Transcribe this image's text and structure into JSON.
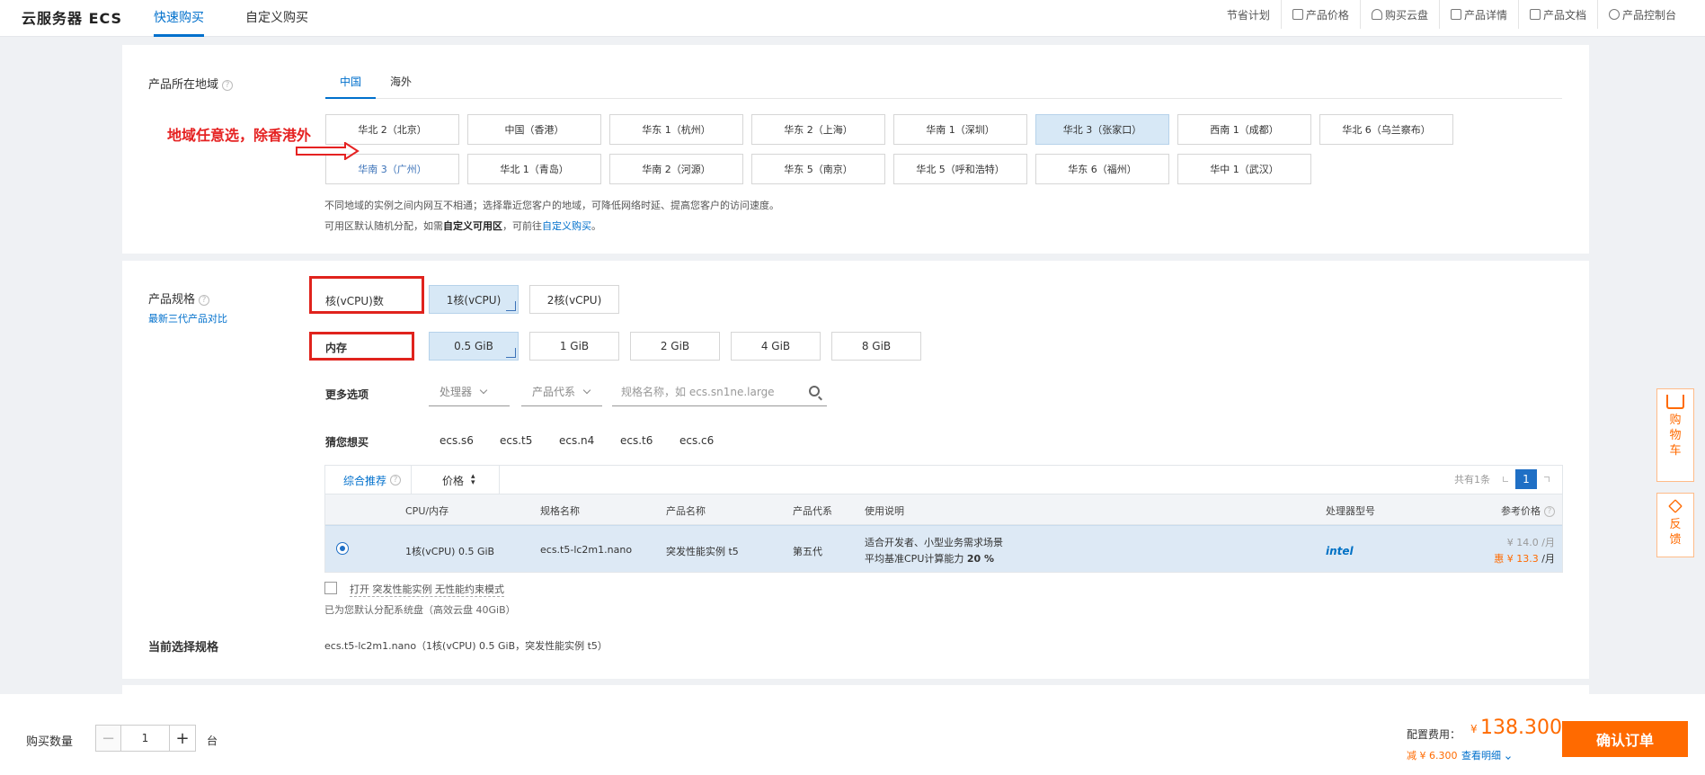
{
  "header": {
    "brand": "云服务器 ECS",
    "tabs": [
      "快速购买",
      "自定义购买"
    ],
    "right_links": [
      "节省计划",
      "产品价格",
      "购买云盘",
      "产品详情",
      "产品文档",
      "产品控制台"
    ]
  },
  "region": {
    "label": "产品所在地域",
    "tabs": [
      "中国",
      "海外"
    ],
    "buttons_row1": [
      "华北 2（北京）",
      "中国（香港）",
      "华东 1（杭州）",
      "华东 2（上海）",
      "华南 1（深圳）",
      "华北 3（张家口）",
      "西南 1（成都）",
      "华北 6（乌兰察布）"
    ],
    "buttons_row2": [
      "华南 3（广州）",
      "华北 1（青岛）",
      "华南 2（河源）",
      "华东 5（南京）",
      "华北 5（呼和浩特）",
      "华东 6（福州）",
      "华中 1（武汉）"
    ],
    "selected": "华北 3（张家口）",
    "note1": "不同地域的实例之间内网互不相通；选择靠近您客户的地域，可降低网络时延、提高您客户的访问速度。",
    "note2_pre": "可用区默认随机分配，如需",
    "note2_bold": "自定义可用区",
    "note2_mid": "，可前往",
    "note2_link": "自定义购买",
    "note2_post": "。"
  },
  "annotation": {
    "text": "地域任意选，除香港外",
    "color": "#e52222"
  },
  "spec": {
    "label": "产品规格",
    "compare_link": "最新三代产品对比",
    "cpu_label": "核(vCPU)数",
    "cpu_options": [
      "1核(vCPU)",
      "2核(vCPU)"
    ],
    "mem_label": "内存",
    "mem_options": [
      "0.5 GiB",
      "1 GiB",
      "2 GiB",
      "4 GiB",
      "8 GiB"
    ],
    "more_label": "更多选项",
    "dropdown_processor": "处理器",
    "dropdown_gen": "产品代系",
    "search_placeholder": "规格名称，如 ecs.sn1ne.large",
    "guess_label": "猜您想买",
    "guess_items": [
      "ecs.s6",
      "ecs.t5",
      "ecs.n4",
      "ecs.t6",
      "ecs.c6"
    ]
  },
  "table": {
    "tab_recommend": "综合推荐",
    "tab_price": "价格",
    "total": "共有1条",
    "page": "1",
    "headers": [
      "CPU/内存",
      "规格名称",
      "产品名称",
      "产品代系",
      "使用说明",
      "处理器型号",
      "参考价格"
    ],
    "row": {
      "cpu_mem": "1核(vCPU) 0.5 GiB",
      "spec_name": "ecs.t5-lc2m1.nano",
      "product_name": "突发性能实例 t5",
      "generation": "第五代",
      "desc1": "适合开发者、小型业务需求场景",
      "desc2_pre": "平均基准CPU计算能力 ",
      "desc2_bold": "20 %",
      "processor": "intel",
      "price_orig": "¥ 14.0 /月",
      "price_disc_tag": "惠",
      "price_disc": "¥ 13.3",
      "price_unit": "/月"
    }
  },
  "burst": {
    "checkbox_label": "打开 突发性能实例 无性能约束模式",
    "disk_note": "已为您默认分配系统盘（高效云盘 40GiB）"
  },
  "current": {
    "label": "当前选择规格",
    "value": "ecs.t5-lc2m1.nano（1核(vCPU) 0.5 GiB，突发性能实例 t5）"
  },
  "bottom": {
    "qty_label": "购买数量",
    "qty_value": "1",
    "qty_unit": "台",
    "fee_label": "配置费用：",
    "currency": "¥",
    "fee_value": "138.300",
    "discount": "减 ¥ 6.300",
    "detail_link": "查看明细",
    "confirm": "确认订单"
  },
  "side": {
    "cart": "购物车",
    "feedback": "反馈"
  },
  "colors": {
    "accent": "#0070cc",
    "orange": "#ff6a00",
    "selected_bg": "#d7e8f6"
  }
}
